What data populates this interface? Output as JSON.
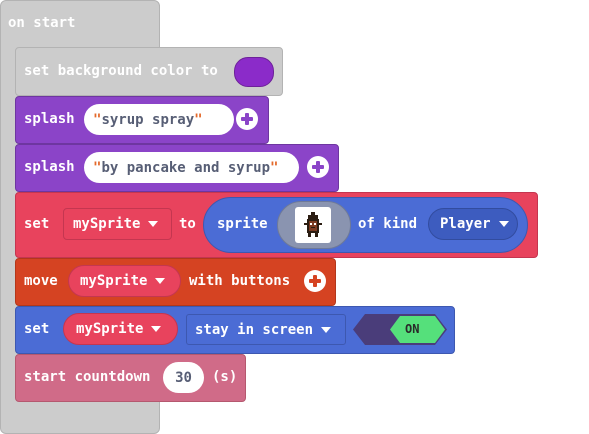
{
  "hat": {
    "label": "on start"
  },
  "bg_block": {
    "label": "set background color to",
    "color_value": "#8b2bc9"
  },
  "splash1": {
    "label": "splash",
    "text": "syrup spray "
  },
  "splash2": {
    "label": "splash",
    "text": "by pancake and syrup"
  },
  "set_sprite": {
    "set_label": "set",
    "variable": "mySprite",
    "to_label": "to",
    "sprite_label": "sprite",
    "of_kind_label": "of kind",
    "kind": "Player"
  },
  "move_block": {
    "label": "move",
    "variable": "mySprite",
    "with_label": "with buttons"
  },
  "stay_block": {
    "set_label": "set",
    "variable": "mySprite",
    "flag": "stay in screen",
    "toggle": "ON"
  },
  "countdown": {
    "label": "start countdown",
    "value": "30",
    "unit": "(s)"
  },
  "icons": {
    "plus": "plus-circle-icon",
    "dropdown": "chevron-down-icon",
    "sprite_thumbnail": "player-sprite-image"
  },
  "colors": {
    "events": "#cccccc",
    "scene": "#4b6cd5",
    "text": "#8b44c8",
    "sprites": "#e8435d",
    "controller": "#d54322",
    "info": "#d06b88",
    "toggle_on": "#55e07b",
    "purple_swatch": "#8b2bc9"
  }
}
